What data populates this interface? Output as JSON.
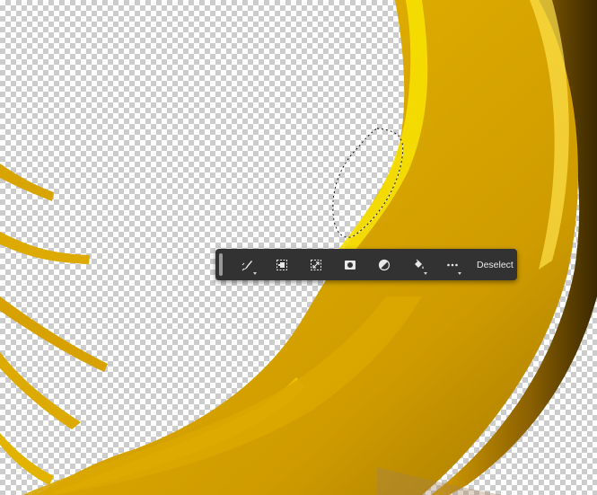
{
  "task_bar": {
    "buttons": [
      {
        "id": "select-subject",
        "icon": "brush-select-icon",
        "has_dropdown": true
      },
      {
        "id": "modify-selection",
        "icon": "modify-selection-icon",
        "has_dropdown": false
      },
      {
        "id": "invert-selection",
        "icon": "invert-selection-icon",
        "has_dropdown": false
      },
      {
        "id": "create-mask",
        "icon": "mask-icon",
        "has_dropdown": false
      },
      {
        "id": "adjustment-layer",
        "icon": "adjustment-circle-icon",
        "has_dropdown": false
      },
      {
        "id": "fill-selection",
        "icon": "paint-bucket-icon",
        "has_dropdown": true
      },
      {
        "id": "more-options",
        "icon": "more-dots-icon",
        "has_dropdown": true
      }
    ],
    "deselect_label": "Deselect"
  },
  "colors": {
    "gold_dark": "#b88600",
    "gold_mid": "#dca600",
    "gold_light": "#f4d400",
    "toolbar_bg": "#323232"
  }
}
